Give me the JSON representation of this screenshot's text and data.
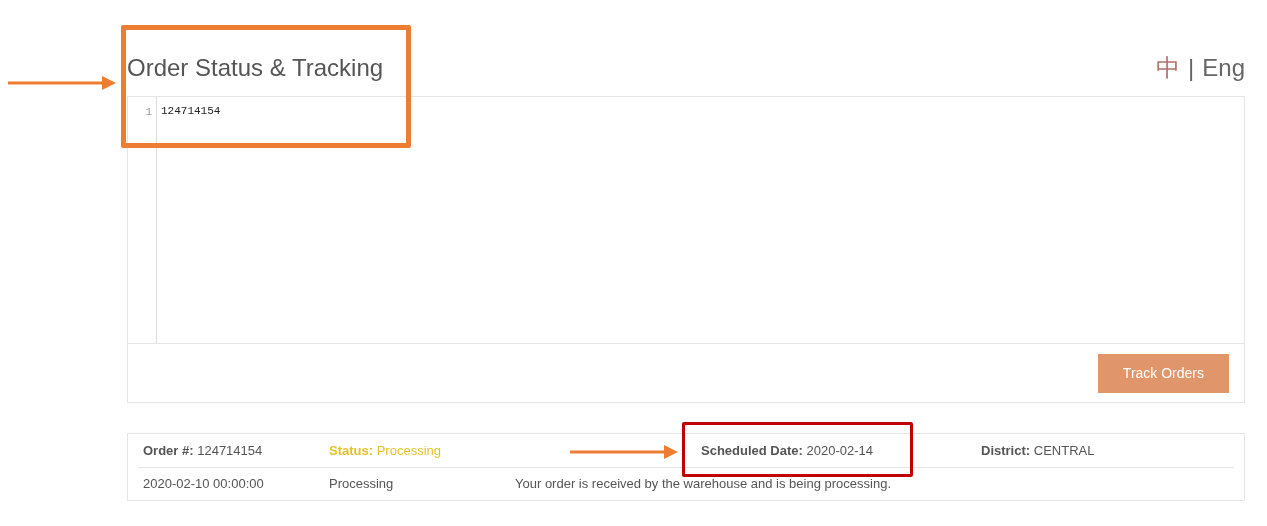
{
  "title": "Order Status & Tracking",
  "language": [
    {
      "label": "中",
      "selected": false
    },
    {
      "label": "Eng",
      "selected": true
    }
  ],
  "language_separator": "|",
  "editor": {
    "lines": [
      {
        "number": "1",
        "text": "124714154"
      }
    ]
  },
  "track_button": "Track Orders",
  "result": {
    "summary": [
      {
        "label": "Order #:",
        "value": "124714154",
        "kind": "plain"
      },
      {
        "label": "Status:",
        "value": "Processing",
        "kind": "status"
      },
      {
        "label": "Scheduled Date:",
        "value": "2020-02-14",
        "kind": "plain"
      },
      {
        "label": "District:",
        "value": "CENTRAL",
        "kind": "plain"
      }
    ],
    "history": [
      {
        "time": "2020-02-10 00:00:00",
        "status": "Processing",
        "message": "Your order is received by the warehouse and is being processing."
      }
    ]
  },
  "annotations": [
    {
      "kind": "arrow",
      "color": "#ed7d31"
    },
    {
      "kind": "box",
      "color": "#ed7d31"
    },
    {
      "kind": "arrow",
      "color": "#ed7d31"
    },
    {
      "kind": "box",
      "color": "#c00000"
    }
  ]
}
